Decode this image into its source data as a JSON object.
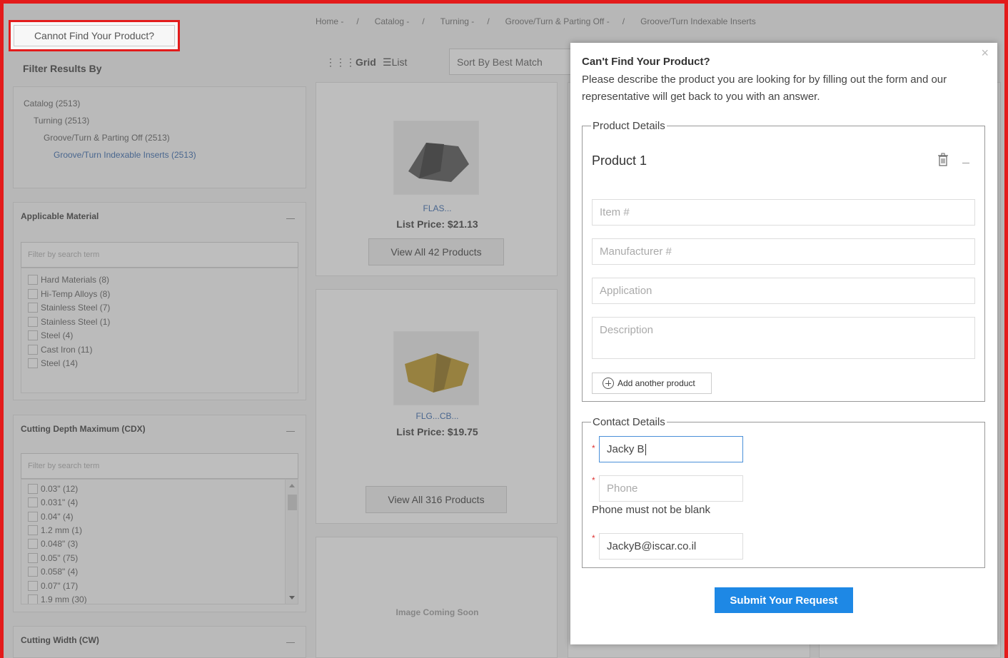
{
  "sidebar": {
    "cannot_find_button": "Cannot Find Your Product?",
    "filter_title": "Filter Results By",
    "catalog_tree": [
      "Catalog (2513)",
      "Turning (2513)",
      "Groove/Turn & Parting Off (2513)",
      "Groove/Turn Indexable Inserts (2513)"
    ],
    "applicable_material": {
      "title": "Applicable Material",
      "placeholder": "Filter by search term",
      "options": [
        "Hard Materials (8)",
        "Hi-Temp Alloys (8)",
        "Stainless Steel (7)",
        "Stainless Steel (1)",
        "Steel (4)",
        "Cast Iron (11)",
        "Steel (14)"
      ]
    },
    "cutting_depth": {
      "title": "Cutting Depth Maximum (CDX)",
      "placeholder": "Filter by search term",
      "options": [
        "0.03\" (12)",
        "0.031\" (4)",
        "0.04\" (4)",
        "1.2 mm (1)",
        "0.048\" (3)",
        "0.05\" (75)",
        "0.058\" (4)",
        "0.07\" (17)",
        "1.9 mm (30)"
      ]
    },
    "cutting_width": {
      "title": "Cutting Width (CW)"
    }
  },
  "breadcrumb": [
    "Home -",
    "Catalog -",
    "Turning -",
    "Groove/Turn & Parting Off -",
    "Groove/Turn Indexable Inserts"
  ],
  "toolbar": {
    "grid_label": "Grid",
    "list_label": "List",
    "sort_label": "Sort By Best Match"
  },
  "products": [
    {
      "name": "FLAS...",
      "price": "List Price: $21.13",
      "view_all": "View All 42 Products"
    },
    {
      "name": "FLG...CB...",
      "price": "List Price: $19.75",
      "view_all": "View All 316 Products"
    },
    {
      "image_placeholder": "Image Coming Soon"
    }
  ],
  "modal": {
    "close": "×",
    "title": "Can't Find Your Product?",
    "description": "Please describe the product you are looking for by filling out the form and our representative will get back to you with an answer.",
    "product_legend": "Product Details",
    "product_title": "Product 1",
    "item_placeholder": "Item #",
    "manufacturer_placeholder": "Manufacturer #",
    "application_placeholder": "Application",
    "description_placeholder": "Description",
    "add_product": "Add another product",
    "contact_legend": "Contact Details",
    "name_value": "Jacky B",
    "phone_placeholder": "Phone",
    "phone_error": "Phone must not be blank",
    "email_value": "JackyB@iscar.co.il",
    "submit": "Submit Your Request"
  },
  "colors": {
    "accent": "#1e88e5",
    "highlight_border": "#e31b1b",
    "link": "#2a5fa8"
  }
}
